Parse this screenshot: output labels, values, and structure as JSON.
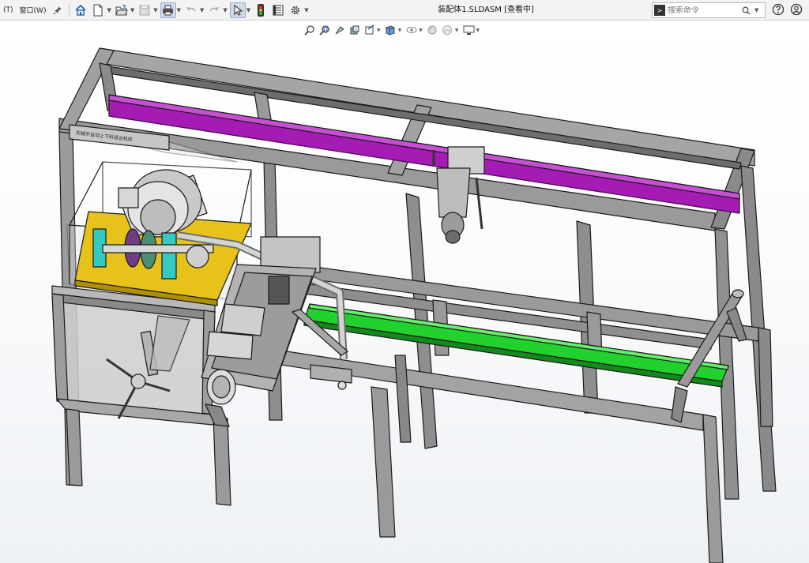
{
  "menu": {
    "tools_label": "(T)",
    "window_label": "窗口(W)"
  },
  "document": {
    "title": "装配体1.SLDASM [查看中]"
  },
  "search": {
    "placeholder": "搜索命令"
  },
  "icons": {
    "pin": "pin-icon",
    "home": "home-icon",
    "new": "new-document-icon",
    "open": "open-folder-icon",
    "save": "save-icon",
    "print": "print-icon",
    "undo": "undo-icon",
    "redo": "redo-icon",
    "select": "select-arrow-icon",
    "rebuild": "traffic-light-icon",
    "file_props": "file-properties-icon",
    "options": "gear-icon",
    "search": "magnifier-icon",
    "help": "question-icon",
    "user": "user-icon"
  },
  "model": {
    "nameplate_text": "机械手自动上下料组合机床"
  },
  "colors": {
    "frame": "#8c8c8c",
    "rail_top": "#a51cb5",
    "conveyor": "#22d12d",
    "motor_base": "#e7c21a",
    "coupling": "#34c9c1",
    "coupling_disc": "#6f3d86"
  }
}
